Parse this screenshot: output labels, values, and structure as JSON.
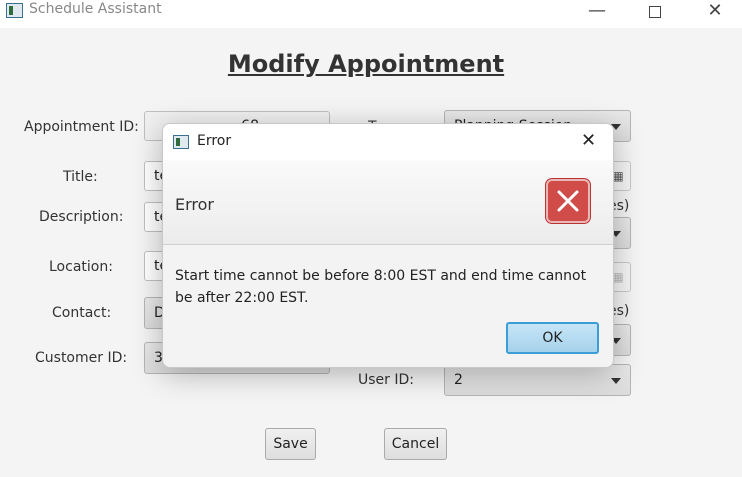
{
  "window": {
    "title": "Schedule Assistant",
    "minimize_glyph": "—",
    "close_glyph": "✕"
  },
  "page": {
    "title": "Modify Appointment"
  },
  "form": {
    "appointment_id": {
      "label": "Appointment ID:",
      "value": "68"
    },
    "title": {
      "label": "Title:",
      "value": "te"
    },
    "description": {
      "label": "Description:",
      "value": "te"
    },
    "location": {
      "label": "Location:",
      "value": "te"
    },
    "contact": {
      "label": "Contact:",
      "value": "D"
    },
    "customer_id": {
      "label": "Customer ID:",
      "value": "3"
    },
    "type": {
      "label": "Type:",
      "value": "Planning Session"
    },
    "user_id": {
      "label": "User ID:",
      "value": "2"
    },
    "partial_time_label_1": "es)",
    "partial_time_label_2": "es)",
    "calendar_icon_glyph": "▦"
  },
  "buttons": {
    "save": "Save",
    "cancel": "Cancel"
  },
  "dialog": {
    "title": "Error",
    "header": "Error",
    "message": "Start time cannot be before 8:00 EST and end time cannot be after 22:00 EST.",
    "ok": "OK",
    "close_glyph": "✕",
    "icon": "error-x-icon",
    "icon_color": "#cf4c49"
  }
}
